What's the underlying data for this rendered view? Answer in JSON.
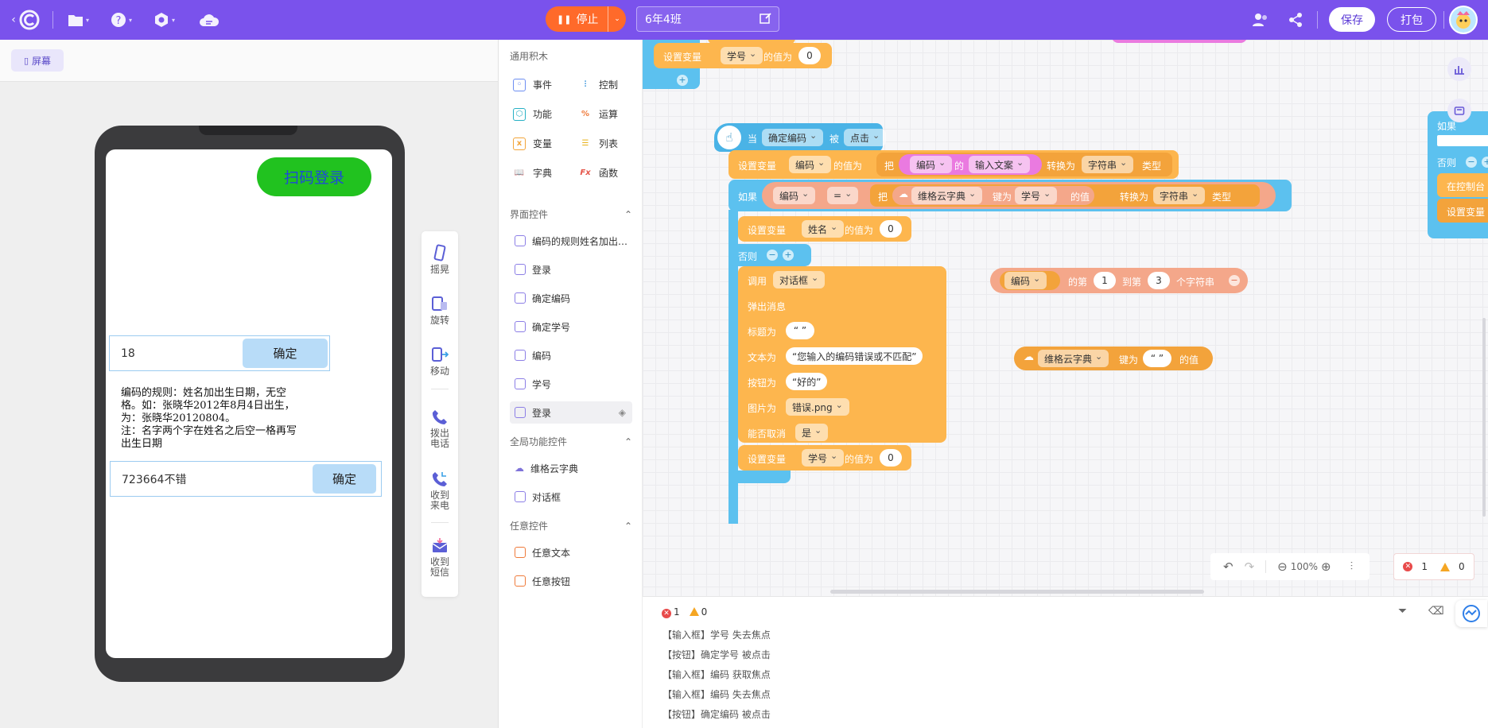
{
  "topbar": {
    "stop_label": "停止",
    "project_name": "6年4班",
    "save_label": "保存",
    "pack_label": "打包"
  },
  "stage": {
    "screen_tab": "屏幕",
    "scan_login": "扫码登录",
    "input1_value": "18",
    "input1_button": "确定",
    "rule_lines": [
      "编码的规则：姓名加出生日期，无空",
      "格。如：张晓华2012年8月4日出生，",
      "为：张晓华20120804。",
      "注：名字两个字在姓名之后空一格再写",
      "出生日期"
    ],
    "input2_value": "723664不错",
    "input2_button": "确定"
  },
  "side_actions": [
    "摇晃",
    "旋转",
    "移动",
    "拨出\n电话",
    "收到\n来电",
    "收到\n短信"
  ],
  "palette": {
    "general_title": "通用积木",
    "grid": [
      "事件",
      "控制",
      "功能",
      "运算",
      "变量",
      "列表",
      "字典",
      "函数"
    ],
    "ui_section": "界面控件",
    "ui_items": [
      "编码的规则姓名加出…",
      "登录",
      "确定编码",
      "确定学号",
      "编码",
      "学号",
      "登录"
    ],
    "global_section": "全局功能控件",
    "global_items": [
      "维格云字典",
      "对话框"
    ],
    "any_section": "任意控件",
    "any_items": [
      "任意文本",
      "任意按钮"
    ]
  },
  "blocks": {
    "top_set": {
      "label": "设置变量",
      "var": "学号",
      "mid": "的值为",
      "value": "0"
    },
    "event": {
      "when": "当",
      "target": "确定编码",
      "by": "被",
      "action": "点击"
    },
    "set1": {
      "label": "设置变量",
      "var": "编码",
      "mid": "的值为",
      "ba": "把",
      "comp": "编码",
      "de": "的",
      "prop": "输入文案",
      "convert": "转换为",
      "type": "字符串",
      "type_word": "类型"
    },
    "if": {
      "label": "如果",
      "left": "编码",
      "op": "=",
      "ba": "把",
      "dict": "维格云字典",
      "key_label": "键为",
      "key": "学号",
      "value_label": "的值",
      "convert": "转换为",
      "type": "字符串",
      "type_word": "类型"
    },
    "set2": {
      "label": "设置变量",
      "var": "姓名",
      "mid": "的值为",
      "value": "0"
    },
    "else": "否则",
    "dialog": {
      "call": "调用",
      "comp": "对话框",
      "popup": "弹出消息",
      "title_label": "标题为",
      "title": "“ ”",
      "text_label": "文本为",
      "text": "“您输入的编码错误或不匹配”",
      "button_label": "按钮为",
      "button": "“好的”",
      "image_label": "图片为",
      "image": "错误.png",
      "cancel_label": "能否取消",
      "cancel": "是"
    },
    "set3": {
      "label": "设置变量",
      "var": "学号",
      "mid": "的值为",
      "value": "0"
    },
    "substr": {
      "var": "编码",
      "t1": "的第",
      "from": "1",
      "t2": "到第",
      "to": "3",
      "t3": "个字符串"
    },
    "dict_get": {
      "dict": "维格云字典",
      "key_label": "键为",
      "key": "“ ”",
      "value_label": "的值"
    },
    "right_if": "如果",
    "right_else": "否则",
    "right_console": "在控制台",
    "right_set": "设置变量"
  },
  "zoom": "100%",
  "errors": "1",
  "warnings": "0",
  "console": {
    "errors": "1",
    "warnings": "0",
    "logs": [
      "【输入框】学号 失去焦点",
      "【按钮】确定学号 被点击",
      "【输入框】编码 获取焦点",
      "【输入框】编码 失去焦点",
      "【按钮】确定编码 被点击"
    ]
  }
}
